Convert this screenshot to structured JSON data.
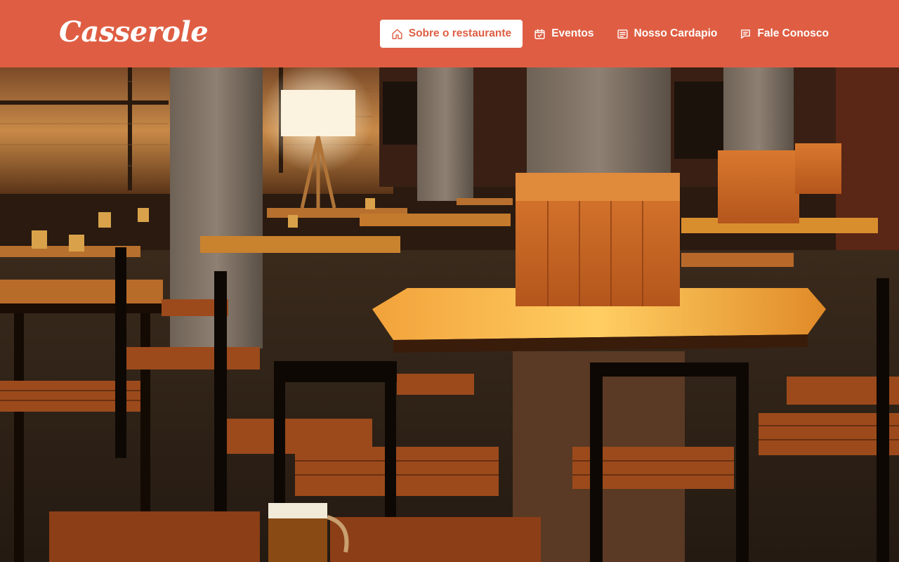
{
  "brand": {
    "name": "Casserole"
  },
  "nav": {
    "items": [
      {
        "label": "Sobre o restaurante",
        "icon": "home-icon",
        "active": true
      },
      {
        "label": "Eventos",
        "icon": "calendar-icon",
        "active": false
      },
      {
        "label": "Nosso Cardapio",
        "icon": "menu-list-icon",
        "active": false
      },
      {
        "label": "Fale Conosco",
        "icon": "chat-icon",
        "active": false
      }
    ]
  },
  "hero": {
    "image": "restaurant-interior-photo",
    "alt": ""
  },
  "colors": {
    "header_bg": "#df5e43",
    "active_text": "#df5e43",
    "nav_text": "#ffffff"
  }
}
